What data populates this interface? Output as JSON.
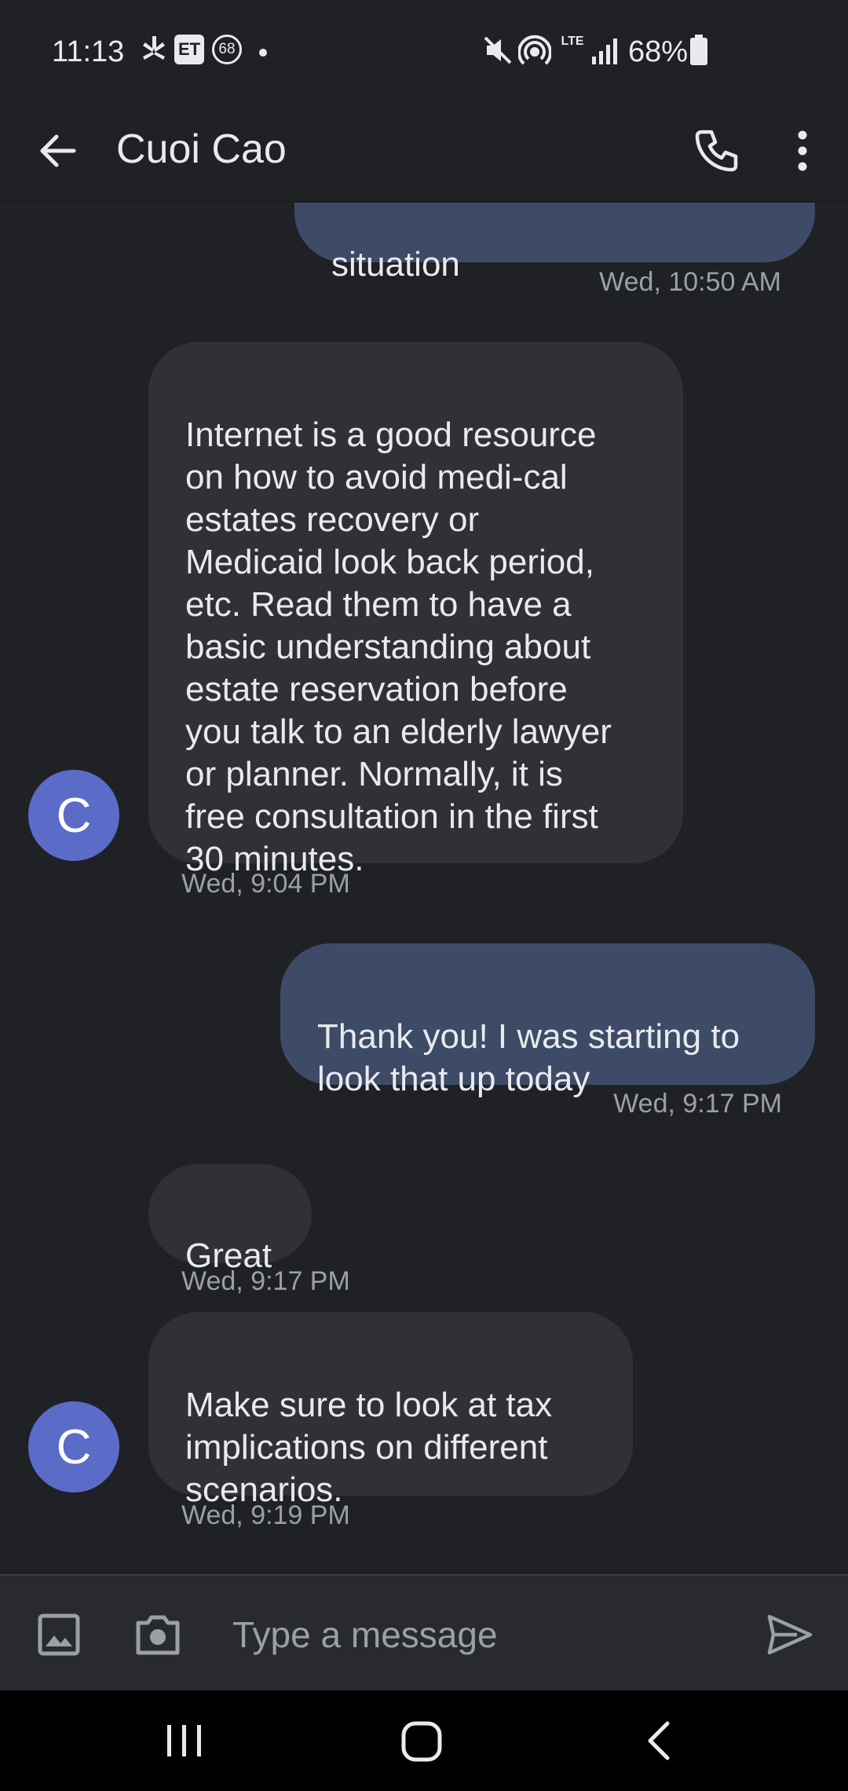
{
  "status_bar": {
    "time": "11:13",
    "battery_percent": "68%",
    "icons": [
      "yelp-icon",
      "et-badge-icon",
      "notification-68-icon",
      "dot-icon",
      "mute-icon",
      "hotspot-icon",
      "lte-icon",
      "signal-icon",
      "battery-icon"
    ]
  },
  "status_bar_labels": {
    "et": "ET",
    "n68": "68",
    "lte": "LTE"
  },
  "header": {
    "contact_name": "Cuoi Cao"
  },
  "messages": [
    {
      "direction": "outgoing",
      "text": "situation",
      "timestamp": "Wed, 10:50 AM"
    },
    {
      "direction": "incoming",
      "avatar": "C",
      "text": "Internet is a good resource\non how to avoid medi-cal\nestates recovery or\nMedicaid look back period,\netc.  Read them to have a\nbasic understanding about\nestate reservation before\nyou talk to an elderly lawyer\nor planner.  Normally, it is\nfree consultation in the first\n30 minutes.",
      "timestamp": "Wed, 9:04 PM"
    },
    {
      "direction": "outgoing",
      "text": "Thank you! I was starting to\nlook that up today",
      "timestamp": "Wed, 9:17 PM"
    },
    {
      "direction": "incoming",
      "text": "Great",
      "timestamp": "Wed, 9:17 PM"
    },
    {
      "direction": "incoming",
      "avatar": "C",
      "text": "Make sure to look at tax\nimplications on different\nscenarios.",
      "timestamp": "Wed, 9:19 PM"
    }
  ],
  "compose": {
    "placeholder": "Type a message"
  },
  "colors": {
    "background": "#202125",
    "outgoing_bubble": "#3d4b67",
    "incoming_bubble": "#303134",
    "avatar": "#5b6bc8",
    "secondary_text": "#9aa0a6"
  }
}
